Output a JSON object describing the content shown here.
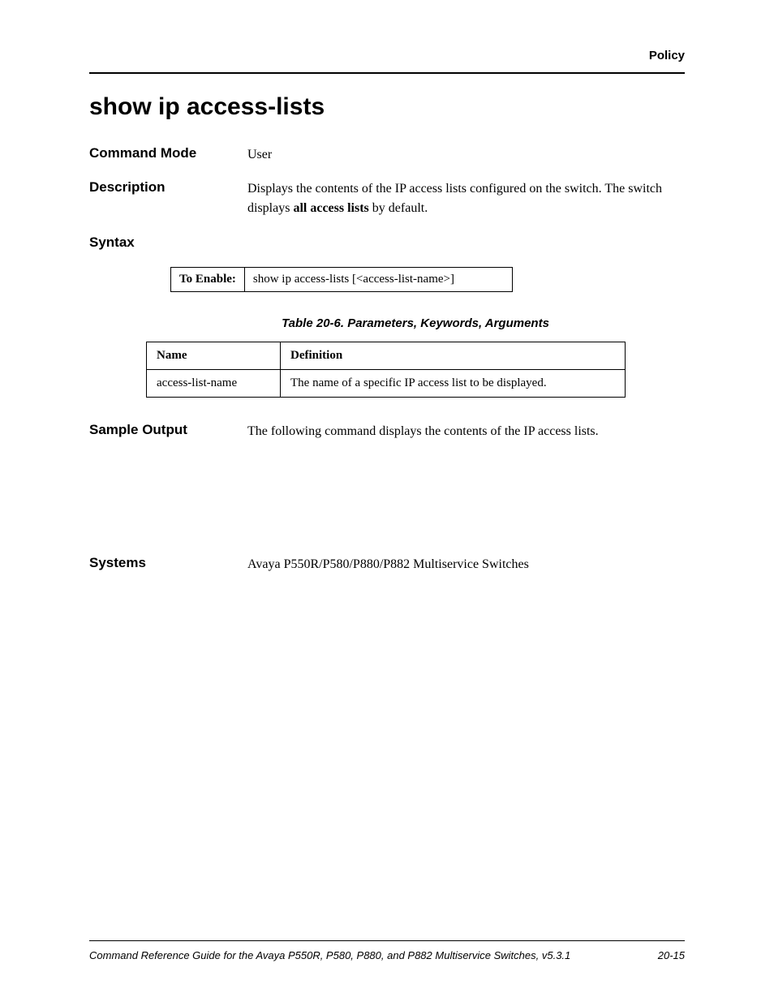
{
  "header": {
    "category": "Policy"
  },
  "title": "show ip access-lists",
  "command_mode": {
    "label": "Command Mode",
    "value": "User"
  },
  "description": {
    "label": "Description",
    "text_pre": "Displays the contents of the IP access lists configured on the switch. The switch displays ",
    "text_bold": "all access lists",
    "text_post": " by default."
  },
  "syntax": {
    "label": "Syntax",
    "to_enable_label": "To Enable:",
    "to_enable_value": "show ip access-lists [<access-list-name>]"
  },
  "param_table": {
    "caption": "Table 20-6.  Parameters, Keywords, Arguments",
    "header_name": "Name",
    "header_def": "Definition",
    "rows": [
      {
        "name": "access-list-name",
        "def": "The name of a specific IP access list to be displayed."
      }
    ]
  },
  "sample_output": {
    "label": "Sample Output",
    "value": "The following command displays the contents of the IP access lists."
  },
  "systems": {
    "label": "Systems",
    "value": "Avaya P550R/P580/P880/P882 Multiservice Switches"
  },
  "footer": {
    "guide": "Command Reference Guide for the Avaya P550R, P580, P880, and P882 Multiservice Switches, v5.3.1",
    "page": "20-15"
  }
}
